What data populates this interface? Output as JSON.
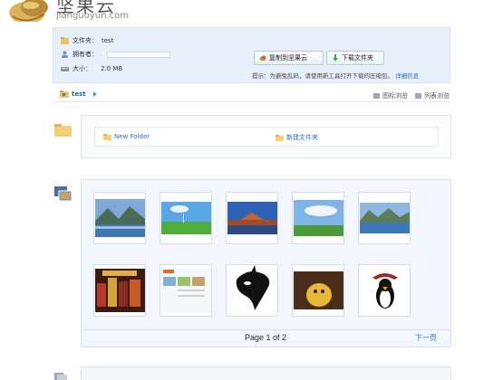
{
  "brand": {
    "title": "坚果云",
    "subtitle": "jianguoyun.com"
  },
  "info": {
    "folder_label": "文件夹：",
    "folder_value": "test",
    "owner_label": "拥有者：",
    "size_label": "大小：",
    "size_value": "2.0 MB"
  },
  "actions": {
    "copy_label": "复制到坚果云",
    "download_label": "下载文件夹",
    "hint_text": "提示：为避免乱码，请使用新工具打开下载的压缩包。",
    "hint_link": "详细信息"
  },
  "breadcrumb": {
    "current": "test"
  },
  "view": {
    "icon_view": "图标浏览",
    "list_view": "列表浏览"
  },
  "folders": [
    {
      "name": "New Folder"
    },
    {
      "name": "新建文件夹"
    }
  ],
  "pager": {
    "text": "Page 1 of 2",
    "next": "下一页"
  },
  "colors": {
    "accent": "#2a6cb8",
    "panel": "#e8f1fb",
    "border": "#d6e3f2"
  }
}
